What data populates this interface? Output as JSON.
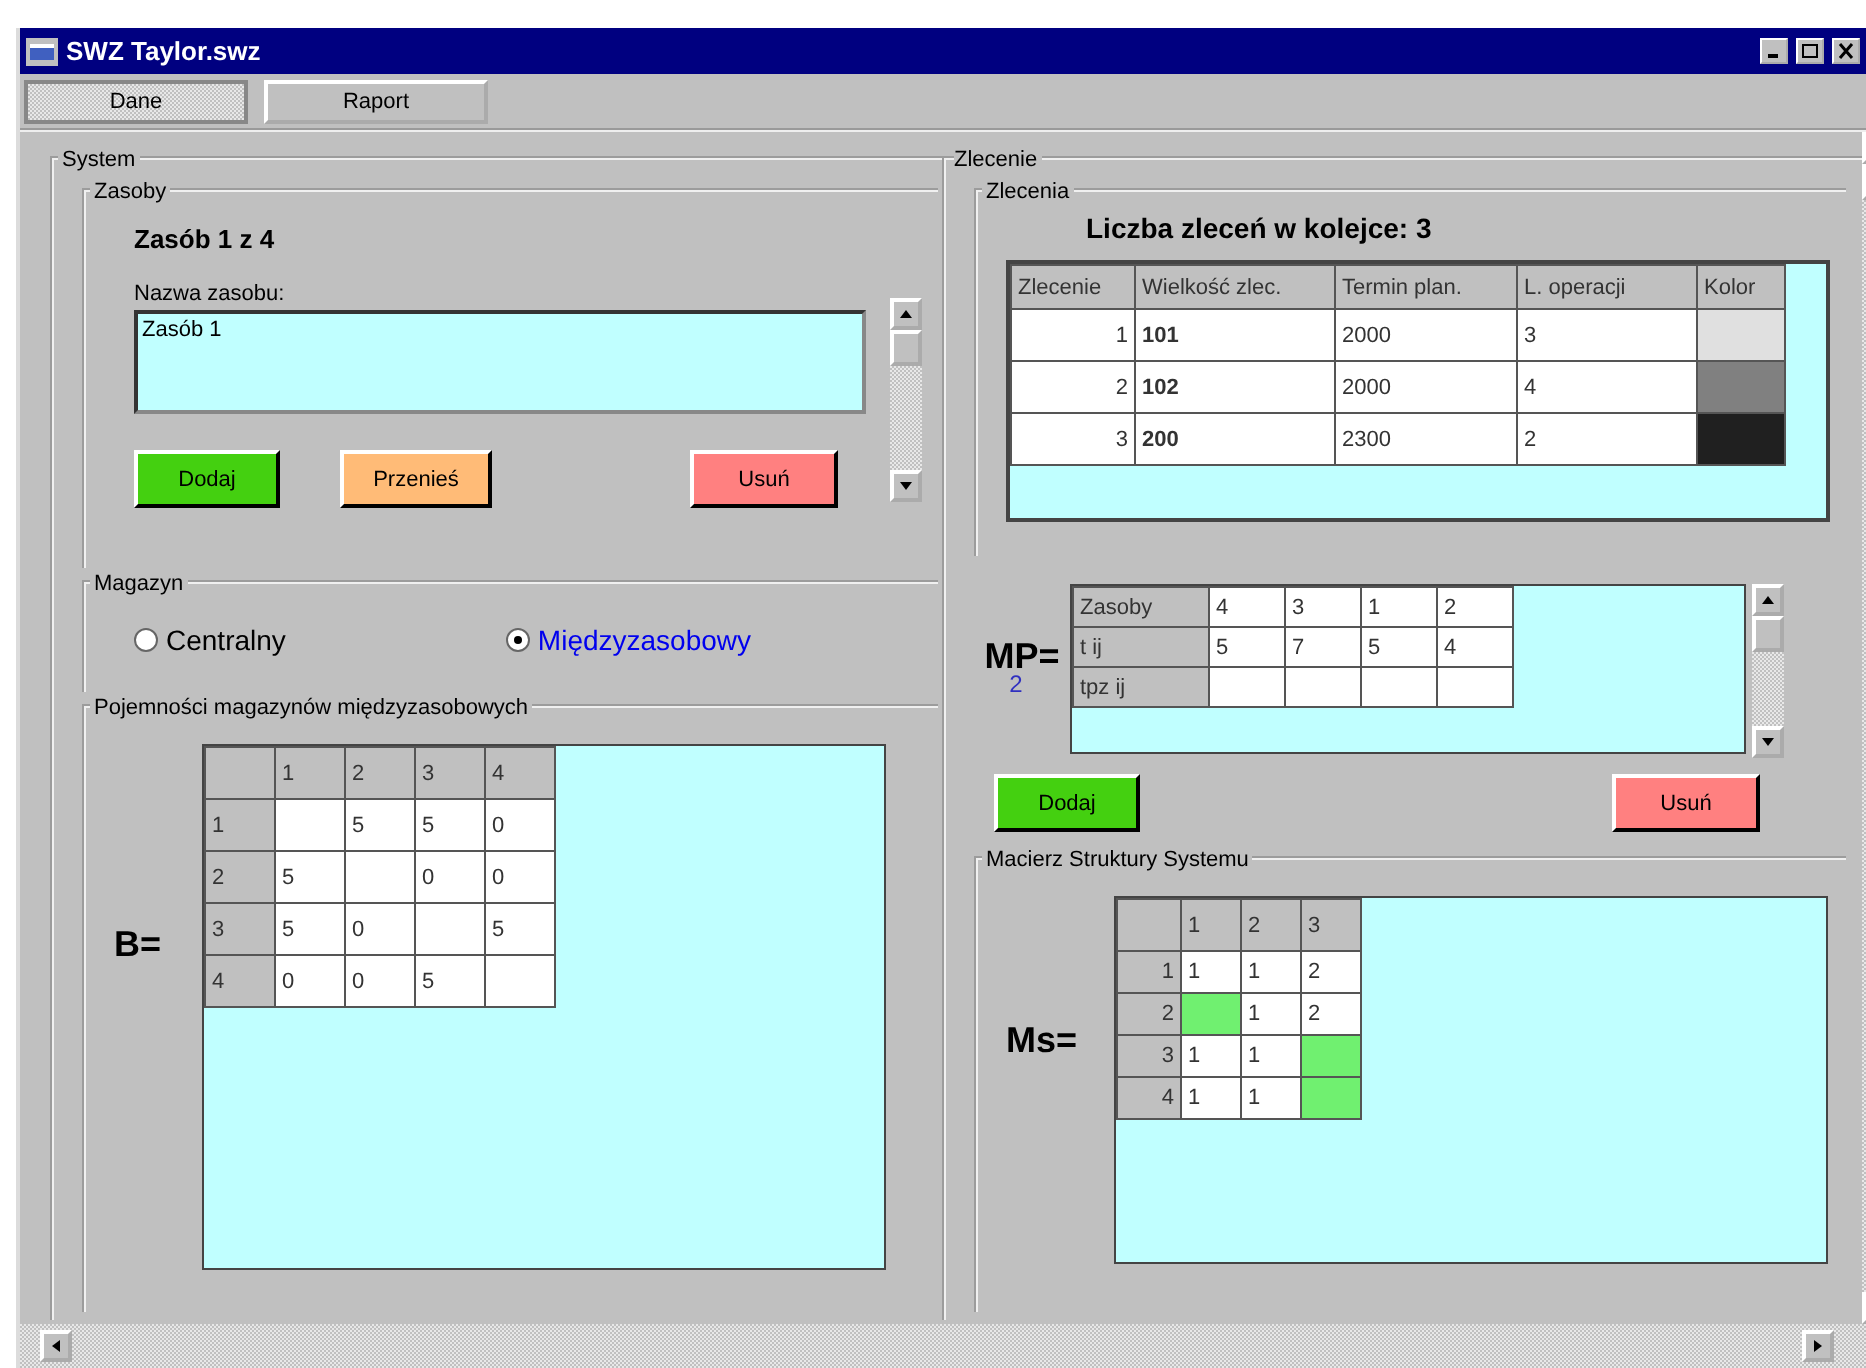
{
  "window": {
    "title": "SWZ Taylor.swz"
  },
  "tabs": [
    {
      "label": "Dane",
      "selected": true
    },
    {
      "label": "Raport",
      "selected": false
    }
  ],
  "system": {
    "title": "System",
    "zasoby": {
      "title": "Zasoby",
      "counter": "Zasób 1 z 4",
      "name_label": "Nazwa zasobu:",
      "name_value": "Zasób 1",
      "buttons": [
        {
          "label": "Dodaj",
          "kind": "add"
        },
        {
          "label": "Przenieś",
          "kind": "move"
        },
        {
          "label": "Usuń",
          "kind": "delete"
        }
      ]
    },
    "magazyn": {
      "title": "Magazyn",
      "options": [
        {
          "label": "Centralny",
          "selected": false
        },
        {
          "label": "Międzyzasobowy",
          "selected": true
        }
      ]
    },
    "capacity": {
      "title": "Pojemności magazynów międzyzasobowych",
      "label": "B=",
      "columns": [
        "1",
        "2",
        "3",
        "4"
      ],
      "rows": [
        {
          "header": "1",
          "cells": [
            null,
            "5",
            "5",
            "0"
          ]
        },
        {
          "header": "2",
          "cells": [
            "5",
            null,
            "0",
            "0"
          ]
        },
        {
          "header": "3",
          "cells": [
            "5",
            "0",
            null,
            "5"
          ]
        },
        {
          "header": "4",
          "cells": [
            "0",
            "0",
            "5",
            null
          ]
        }
      ]
    }
  },
  "zlecenie": {
    "title": "Zlecenie",
    "zlecenia": {
      "title": "Zlecenia",
      "count": "Liczba zleceń w kolejce: 3",
      "columns": [
        "Zlecenie",
        "Wielkość zlec.",
        "Termin plan.",
        "L. operacji",
        "Kolor"
      ],
      "rows": [
        {
          "cells": [
            "1",
            "101",
            "2000",
            "3"
          ],
          "color": "#e0e0e0"
        },
        {
          "cells": [
            "2",
            "102",
            "2000",
            "4"
          ],
          "color": "#808080"
        },
        {
          "cells": [
            "3",
            "200",
            "2300",
            "2"
          ],
          "color": "#202020"
        }
      ]
    },
    "mp": {
      "label": "MP=",
      "index": "2",
      "rows": [
        {
          "header": "Zasoby",
          "cells": [
            "4",
            "3",
            "1",
            "2"
          ]
        },
        {
          "header": "t ij",
          "cells": [
            "5",
            "7",
            "5",
            "4"
          ]
        },
        {
          "header": "tpz ij",
          "cells": [
            null,
            null,
            null,
            null
          ]
        }
      ]
    },
    "buttons": [
      {
        "label": "Dodaj",
        "kind": "add"
      },
      {
        "label": "Usuń",
        "kind": "delete"
      }
    ],
    "structure": {
      "title": "Macierz Struktury Systemu",
      "label": "Ms=",
      "columns": [
        "1",
        "2",
        "3"
      ],
      "rows": [
        {
          "header": "1",
          "cells": [
            {
              "value": "1",
              "highlighted": false
            },
            {
              "value": "1",
              "highlighted": false
            },
            {
              "value": "2",
              "highlighted": false
            }
          ]
        },
        {
          "header": "2",
          "cells": [
            {
              "highlighted": true
            },
            {
              "value": "1",
              "highlighted": false
            },
            {
              "value": "2",
              "highlighted": false
            }
          ]
        },
        {
          "header": "3",
          "cells": [
            {
              "value": "1",
              "highlighted": false
            },
            {
              "value": "1",
              "highlighted": false
            },
            {
              "highlighted": true
            }
          ]
        },
        {
          "header": "4",
          "cells": [
            {
              "value": "1",
              "highlighted": false
            },
            {
              "value": "1",
              "highlighted": false
            },
            {
              "highlighted": true
            }
          ]
        }
      ]
    }
  }
}
